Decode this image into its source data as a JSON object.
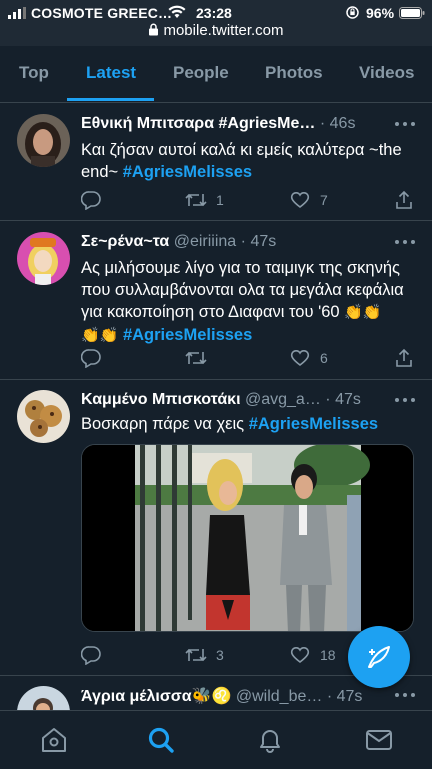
{
  "status_bar": {
    "carrier": "COSMOTE GREEC…",
    "time": "23:28",
    "battery": "96%",
    "url": "mobile.twitter.com"
  },
  "tabs": [
    {
      "label": "Top",
      "active": false
    },
    {
      "label": "Latest",
      "active": true
    },
    {
      "label": "People",
      "active": false
    },
    {
      "label": "Photos",
      "active": false
    },
    {
      "label": "Videos",
      "active": false
    }
  ],
  "tweets": [
    {
      "name": "Εθνική Μπιτσαρα #AgriesMe…",
      "handle": "",
      "time": "46s",
      "text_lines": [
        "Και ζήσαν αυτοί καλά κι εμείς καλύτερα ~the",
        "end~ "
      ],
      "hashtag": "#AgriesMelisses",
      "replies": "",
      "retweets": "1",
      "likes": "7"
    },
    {
      "name": "Σε~ρένα~τα",
      "handle": "@eiriiina",
      "time": "47s",
      "text_lines": [
        "Ας μιλήσουμε λίγο για το ταιμιγκ της σκηνής",
        "που συλλαμβάνονται ολα τα μεγάλα κεφάλια",
        "για κακοποίηση στο Διαφανι του '60 "
      ],
      "claps_line1": "👏👏",
      "claps_line2": "👏👏",
      "hashtag": "#AgriesMelisses",
      "replies": "",
      "retweets": "",
      "likes": "6"
    },
    {
      "name": "Καμμένο Μπισκοτάκι",
      "handle": "@avg_a…",
      "time": "47s",
      "text": "Βοσκαρη πάρε να χεις ",
      "hashtag": "#AgriesMelisses",
      "replies": "",
      "retweets": "3",
      "likes": "18"
    },
    {
      "name": "Άγρια μέλισσα🐝♌",
      "handle": "@wild_be…",
      "time": "47s"
    }
  ],
  "colors": {
    "background": "#15202b",
    "accent": "#1da1f2",
    "secondary_text": "#8899a6",
    "divider": "#38444d"
  },
  "nav": [
    {
      "icon": "home-icon"
    },
    {
      "icon": "search-icon",
      "active": true
    },
    {
      "icon": "notifications-icon"
    },
    {
      "icon": "messages-icon"
    }
  ]
}
